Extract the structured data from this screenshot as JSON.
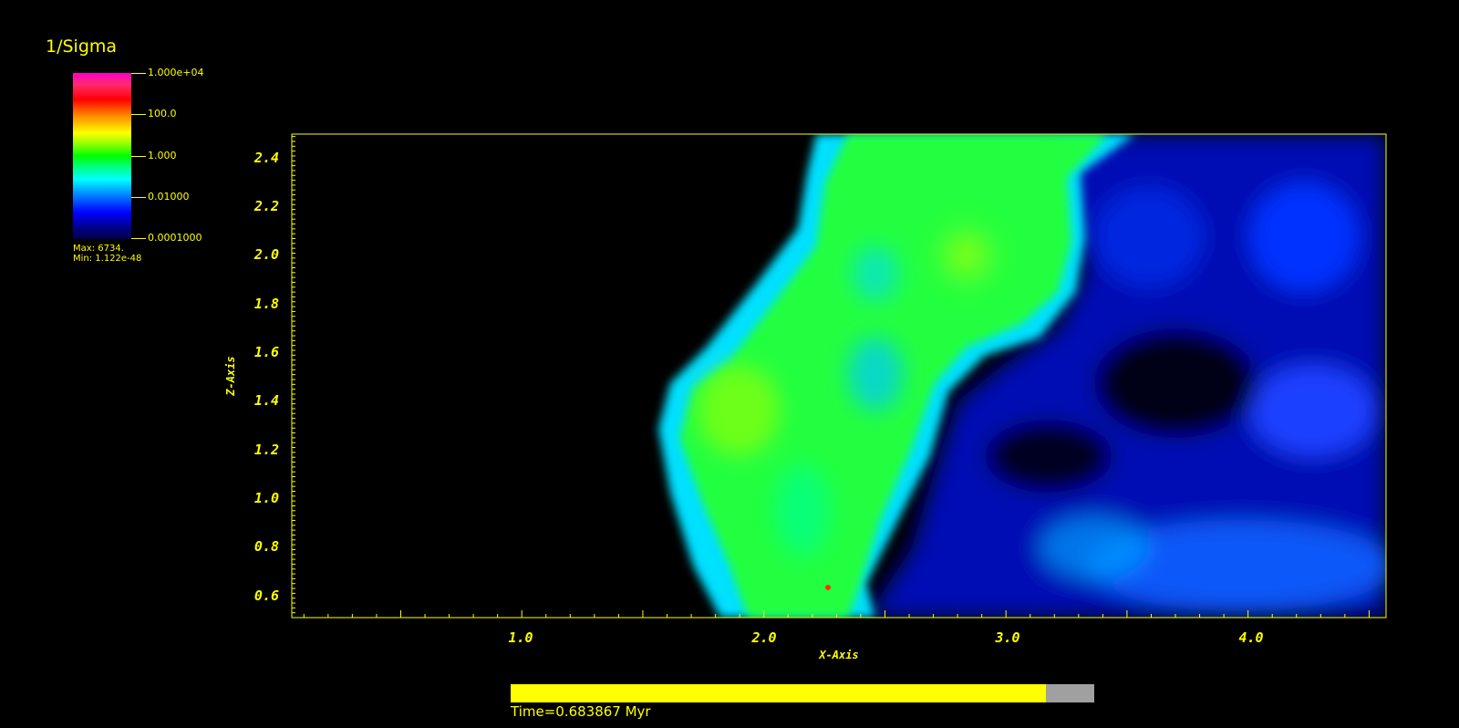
{
  "legend": {
    "variable": "1/Sigma",
    "ticks": [
      "1.000e+04",
      "100.0",
      "1.000",
      "0.01000",
      "0.0001000"
    ],
    "max_label": "Max: 6734.",
    "min_label": "Min: 1.122e-48",
    "max_value": 6734,
    "min_value": 1.122e-48
  },
  "chart_data": {
    "type": "heatmap",
    "xlabel": "X-Axis",
    "ylabel": "Z-Axis",
    "xlim": [
      0.05,
      4.57
    ],
    "ylim": [
      0.51,
      2.5
    ],
    "x_ticks": [
      "1.0",
      "2.0",
      "3.0",
      "4.0"
    ],
    "y_ticks": [
      "0.6",
      "0.8",
      "1.0",
      "1.2",
      "1.4",
      "1.6",
      "1.8",
      "2.0",
      "2.2",
      "2.4"
    ],
    "colorscale": "log",
    "colorscale_range": [
      0.0001,
      10000
    ],
    "background_color": "#000000",
    "axis_color": "#ffff00"
  },
  "time": {
    "label": "Time=0.683867 Myr",
    "progress": 0.917
  }
}
